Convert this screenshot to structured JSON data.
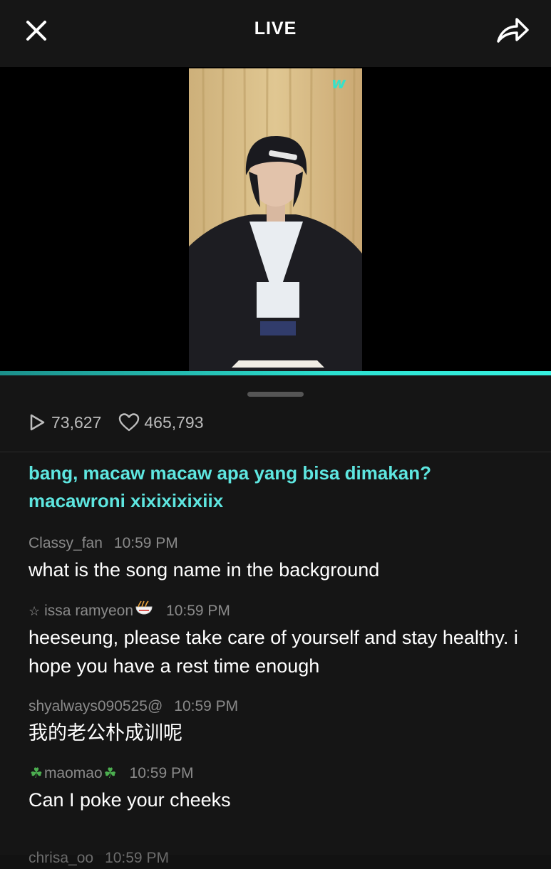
{
  "header": {
    "title": "LIVE"
  },
  "video": {
    "watermark": "w"
  },
  "stats": {
    "views": "73,627",
    "likes": "465,793"
  },
  "notice": {
    "text": "bang, macaw macaw apa yang bisa dimakan? macawroni xixixixixiix"
  },
  "comments": [
    {
      "user": "Classy_fan",
      "time": "10:59 PM",
      "text": "what is the song name in the background"
    },
    {
      "user": "issa ramyeon",
      "time": "10:59 PM",
      "text": "heeseung, please take care of yourself and stay healthy. i hope you have a rest time enough"
    },
    {
      "user": "shyalways090525@",
      "time": "10:59 PM",
      "text": "我的老公朴成训呢"
    },
    {
      "user": "maomao",
      "time": "10:59 PM",
      "text": "Can I poke your cheeks"
    },
    {
      "user": "chrisa_oo",
      "time": "10:59 PM"
    }
  ],
  "colors": {
    "accent": "#5ee6e0",
    "progress": "#2ce0d0",
    "background": "#121212"
  },
  "icons": [
    "close-icon",
    "share-icon",
    "play-icon",
    "heart-icon",
    "noodle-icon",
    "clover-icon",
    "star-icon"
  ]
}
